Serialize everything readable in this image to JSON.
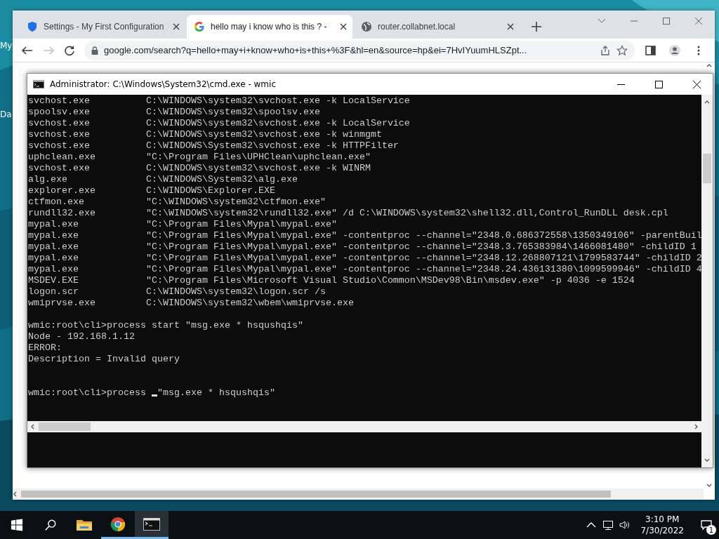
{
  "desktop": {
    "icons": [
      {
        "label": "My"
      },
      {
        "label": "Da"
      }
    ]
  },
  "browser": {
    "tabs": [
      {
        "title": "Settings - My First Configuration",
        "selected": false
      },
      {
        "title": "hello may i know who is this ? -",
        "selected": true
      },
      {
        "title": "router.collabnet.local",
        "selected": false
      }
    ],
    "address": "google.com/search?q=hello+may+i+know+who+is+this+%3F&hl=en&source=hp&ei=7HvIYuumHLSZpt...",
    "forward_disabled": true
  },
  "console": {
    "title": "Administrator: C:\\Windows\\System32\\cmd.exe - wmic",
    "rows": [
      {
        "name": "svchost.exe",
        "command": "C:\\WINDOWS\\system32\\svchost.exe -k LocalService"
      },
      {
        "name": "spoolsv.exe",
        "command": "C:\\WINDOWS\\system32\\spoolsv.exe"
      },
      {
        "name": "svchost.exe",
        "command": "C:\\WINDOWS\\system32\\svchost.exe -k LocalService"
      },
      {
        "name": "svchost.exe",
        "command": "C:\\WINDOWS\\system32\\svchost.exe -k winmgmt"
      },
      {
        "name": "svchost.exe",
        "command": "C:\\WINDOWS\\System32\\svchost.exe -k HTTPFilter"
      },
      {
        "name": "uphclean.exe",
        "command": "\"C:\\Program Files\\UPHClean\\uphclean.exe\""
      },
      {
        "name": "svchost.exe",
        "command": "C:\\WINDOWS\\system32\\svchost.exe -k WINRM"
      },
      {
        "name": "alg.exe",
        "command": "C:\\WINDOWS\\System32\\alg.exe"
      },
      {
        "name": "explorer.exe",
        "command": "C:\\WINDOWS\\Explorer.EXE"
      },
      {
        "name": "ctfmon.exe",
        "command": "\"C:\\WINDOWS\\system32\\ctfmon.exe\""
      },
      {
        "name": "rundll32.exe",
        "command": "\"C:\\WINDOWS\\system32\\rundll32.exe\" /d C:\\WINDOWS\\system32\\shell32.dll,Control_RunDLL desk.cpl"
      },
      {
        "name": "mypal.exe",
        "command": "\"C:\\Program Files\\Mypal\\mypal.exe\""
      },
      {
        "name": "mypal.exe",
        "command": "\"C:\\Program Files\\Mypal\\mypal.exe\" -contentproc --channel=\"2348.0.686372558\\1350349106\" -parentBuil"
      },
      {
        "name": "mypal.exe",
        "command": "\"C:\\Program Files\\Mypal\\mypal.exe\" -contentproc --channel=\"2348.3.765383984\\1466081480\" -childID 1"
      },
      {
        "name": "mypal.exe",
        "command": "\"C:\\Program Files\\Mypal\\mypal.exe\" -contentproc --channel=\"2348.12.268807121\\1799583744\" -childID 2"
      },
      {
        "name": "mypal.exe",
        "command": "\"C:\\Program Files\\Mypal\\mypal.exe\" -contentproc --channel=\"2348.24.436131380\\1099599946\" -childID 4"
      },
      {
        "name": "MSDEV.EXE",
        "command": "\"C:\\Program Files\\Microsoft Visual Studio\\Common\\MSDev98\\Bin\\msdev.exe\" -p 4036 -e 1524"
      },
      {
        "name": "logon.scr",
        "command": "C:\\WINDOWS\\system32\\logon.scr /s"
      },
      {
        "name": "wmiprvse.exe",
        "command": "C:\\WINDOWS\\system32\\wbem\\wmiprvse.exe"
      }
    ],
    "output": [
      "wmic:root\\cli>process start \"msg.exe * hsqushqis\"",
      "Node - 192.168.1.12",
      "ERROR:",
      "Description = Invalid query"
    ],
    "prompt": {
      "before": "wmic:root\\cli>process ",
      "after": "\"msg.exe * hsqushqis\""
    }
  },
  "taskbar": {
    "apps": [
      {
        "kind": "start",
        "running": false,
        "selected": false
      },
      {
        "kind": "search",
        "running": false,
        "selected": false
      },
      {
        "kind": "folder",
        "running": false,
        "selected": false
      },
      {
        "kind": "chrome",
        "running": true,
        "selected": false
      },
      {
        "kind": "terminal",
        "running": true,
        "selected": true
      }
    ],
    "time": "3:10 PM",
    "date": "7/30/2022",
    "notifications": "1"
  }
}
